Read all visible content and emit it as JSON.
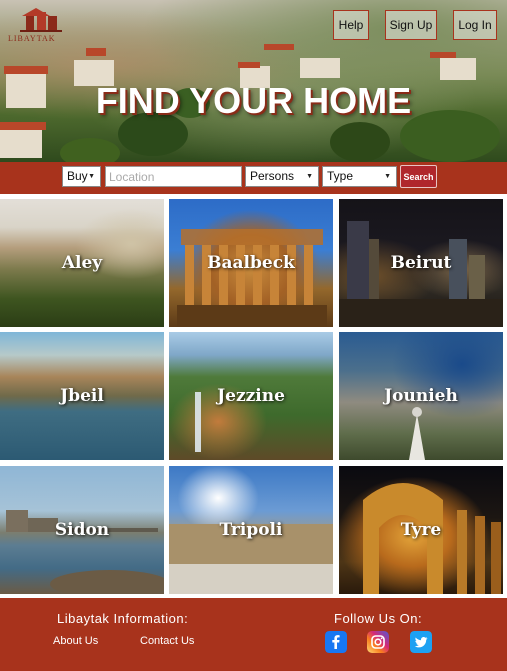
{
  "header": {
    "logo_text": "LIBAYTAK",
    "nav": {
      "help": "Help",
      "signup": "Sign Up",
      "login": "Log In"
    },
    "hero_title": "FIND YOUR HOME"
  },
  "search": {
    "buy_value": "Buy",
    "location_placeholder": "Location",
    "persons_value": "Persons",
    "type_value": "Type",
    "search_label": "Search"
  },
  "locations": [
    {
      "name": "Aley"
    },
    {
      "name": "Baalbeck"
    },
    {
      "name": "Beirut"
    },
    {
      "name": "Jbeil"
    },
    {
      "name": "Jezzine"
    },
    {
      "name": "Jounieh"
    },
    {
      "name": "Sidon"
    },
    {
      "name": "Tripoli"
    },
    {
      "name": "Tyre"
    }
  ],
  "footer": {
    "info_heading": "Libaytak Information:",
    "about": "About Us",
    "contact": "Contact Us",
    "follow_heading": "Follow Us On:",
    "social": [
      "facebook-icon",
      "instagram-icon",
      "twitter-icon"
    ]
  },
  "colors": {
    "brand": "#a8331c",
    "search_button": "#b0272c",
    "facebook": "#1877f2",
    "twitter": "#1da1f2"
  }
}
